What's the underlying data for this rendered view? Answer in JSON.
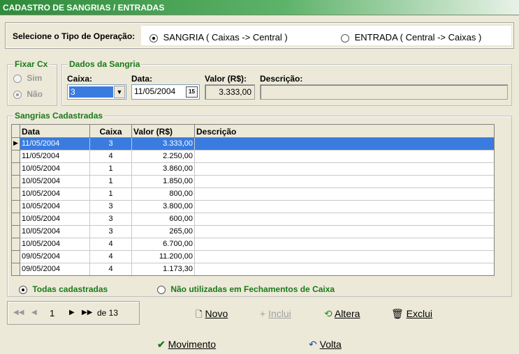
{
  "window": {
    "title": "CADASTRO DE SANGRIAS / ENTRADAS"
  },
  "operation": {
    "label": "Selecione o Tipo de Operação:",
    "options": [
      {
        "label": "SANGRIA  ( Caixas -> Central )",
        "selected": true
      },
      {
        "label": "ENTRADA  ( Central -> Caixas )",
        "selected": false
      }
    ]
  },
  "fixar_cx": {
    "title": "Fixar Cx",
    "options": [
      {
        "label": "Sim",
        "selected": false
      },
      {
        "label": "Não",
        "selected": true
      }
    ]
  },
  "dados": {
    "title": "Dados da Sangria",
    "caixa_label": "Caixa:",
    "caixa_value": "3",
    "data_label": "Data:",
    "data_value": "11/05/2004",
    "calendar_icon_text": "15",
    "valor_label": "Valor (R$):",
    "valor_value": "3.333,00",
    "descricao_label": "Descrição:",
    "descricao_value": ""
  },
  "sangrias": {
    "title": "Sangrias Cadastradas",
    "columns": [
      "Data",
      "Caixa",
      "Valor (R$)",
      "Descrição"
    ],
    "rows": [
      {
        "data": "11/05/2004",
        "caixa": "3",
        "valor": "3.333,00",
        "descricao": ""
      },
      {
        "data": "11/05/2004",
        "caixa": "4",
        "valor": "2.250,00",
        "descricao": ""
      },
      {
        "data": "10/05/2004",
        "caixa": "1",
        "valor": "3.860,00",
        "descricao": ""
      },
      {
        "data": "10/05/2004",
        "caixa": "1",
        "valor": "1.850,00",
        "descricao": ""
      },
      {
        "data": "10/05/2004",
        "caixa": "1",
        "valor": "800,00",
        "descricao": ""
      },
      {
        "data": "10/05/2004",
        "caixa": "3",
        "valor": "3.800,00",
        "descricao": ""
      },
      {
        "data": "10/05/2004",
        "caixa": "3",
        "valor": "600,00",
        "descricao": ""
      },
      {
        "data": "10/05/2004",
        "caixa": "3",
        "valor": "265,00",
        "descricao": ""
      },
      {
        "data": "10/05/2004",
        "caixa": "4",
        "valor": "6.700,00",
        "descricao": ""
      },
      {
        "data": "09/05/2004",
        "caixa": "4",
        "valor": "11.200,00",
        "descricao": ""
      },
      {
        "data": "09/05/2004",
        "caixa": "4",
        "valor": "1.173,30",
        "descricao": ""
      }
    ],
    "filter_options": [
      {
        "label": "Todas cadastradas",
        "selected": true
      },
      {
        "label": "Não utilizadas em Fechamentos de Caixa",
        "selected": false
      }
    ]
  },
  "navigator": {
    "page": "1",
    "total": "de 13"
  },
  "actions": {
    "novo": "Novo",
    "inclui": "Inclui",
    "altera": "Altera",
    "exclui": "Exclui",
    "movimento": "Movimento",
    "volta": "Volta"
  },
  "colors": {
    "accent_green": "#1a7a1a",
    "selection_blue": "#3A7BE0",
    "titlebar_green": "#2E8B3A"
  }
}
